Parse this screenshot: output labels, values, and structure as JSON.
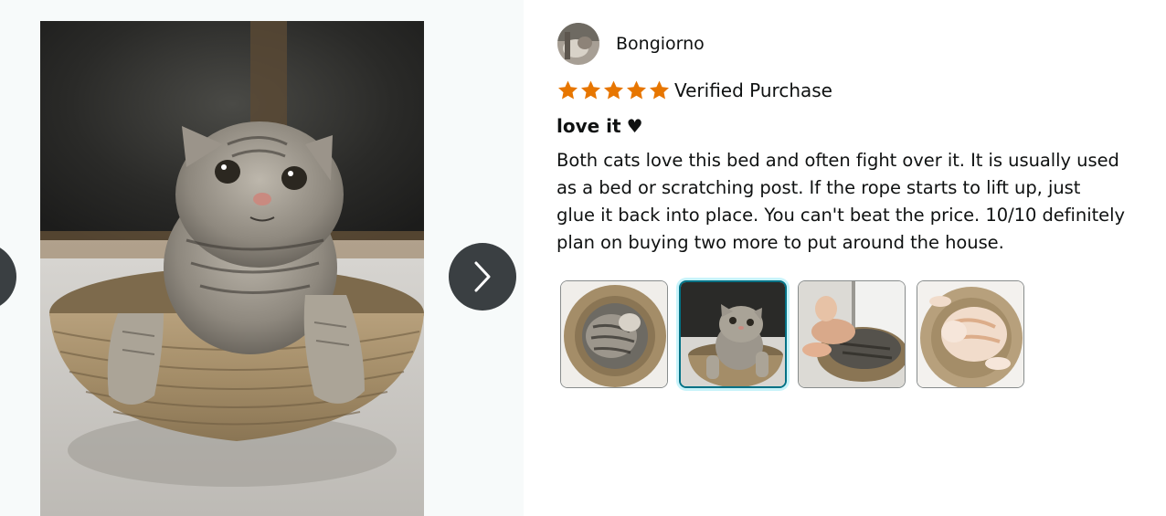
{
  "viewer": {
    "main_image": "cat-in-rope-bed-photo",
    "prev_icon": "chevron-left-icon",
    "next_icon": "chevron-right-icon"
  },
  "review": {
    "profile_name": "Bongiorno",
    "rating": 5,
    "rating_max": 5,
    "star_color": "#e77600",
    "verified_label": "Verified Purchase",
    "title": "love it",
    "title_icon": "♥",
    "body_lines": [
      "Both cats love this bed and often fight over it. It is usually used",
      "as a bed or scratching post. If the rope starts to lift up, just",
      "glue it back into place. You can't beat the price. 10/10 definitely",
      "plan on buying two more to put around the house."
    ],
    "thumbnails": [
      {
        "name": "thumb-cat-curled-in-bed",
        "selected": false
      },
      {
        "name": "thumb-cat-sitting-in-bed",
        "selected": true
      },
      {
        "name": "thumb-cats-sleeping-window",
        "selected": false
      },
      {
        "name": "thumb-orange-cat-sleeping",
        "selected": false
      }
    ]
  }
}
